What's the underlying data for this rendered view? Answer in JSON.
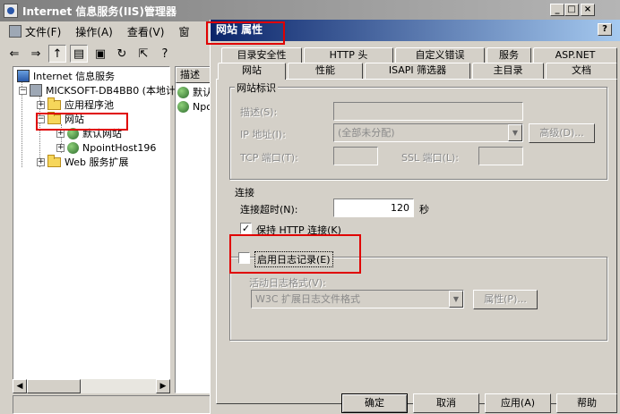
{
  "iis_window": {
    "title": "Internet 信息服务(IIS)管理器",
    "menu": [
      {
        "label": "文件(F)",
        "icon": "app-menu-icon"
      },
      {
        "label": "操作(A)"
      },
      {
        "label": "查看(V)"
      },
      {
        "label": "窗"
      }
    ],
    "toolbar_icons": [
      "back-icon",
      "forward-icon",
      "up-folder-icon",
      "show-tree-icon",
      "properties-icon",
      "refresh-icon",
      "export-icon",
      "help-icon"
    ],
    "tree": {
      "root": "Internet 信息服务",
      "server": "MICKSOFT-DB4BB0 (本地计",
      "app_pools": "应用程序池",
      "websites": "网站",
      "default_site": "默认网站",
      "npoint_site": "NpointHost196",
      "web_ext": "Web 服务扩展"
    },
    "list": {
      "header": "描述",
      "rows": [
        "默认",
        "Npo"
      ]
    }
  },
  "dialog": {
    "title": "网站 属性",
    "tabs_row1": [
      "目录安全性",
      "HTTP 头",
      "自定义错误",
      "服务",
      "ASP.NET"
    ],
    "tabs_row2": [
      "网站",
      "性能",
      "ISAPI 筛选器",
      "主目录",
      "文档"
    ],
    "website_id": {
      "legend": "网站标识",
      "desc_label": "描述(S):",
      "ip_label": "IP 地址(I):",
      "ip_value": "(全部未分配)",
      "advanced_btn": "高级(D)...",
      "tcp_label": "TCP 端口(T):",
      "ssl_label": "SSL 端口(L):"
    },
    "connection": {
      "legend": "连接",
      "timeout_label": "连接超时(N):",
      "timeout_value": "120",
      "timeout_unit": "秒",
      "keepalive_label": "保持 HTTP 连接(K)",
      "keepalive_checked": true
    },
    "logging": {
      "enable_label": "启用日志记录(E)",
      "enable_checked": false,
      "format_label": "活动日志格式(V):",
      "format_value": "W3C 扩展日志文件格式",
      "props_btn": "属性(P)..."
    },
    "footer": {
      "ok": "确定",
      "cancel": "取消",
      "apply": "应用(A)",
      "help": "帮助"
    }
  },
  "highlight_color": "#e00000"
}
